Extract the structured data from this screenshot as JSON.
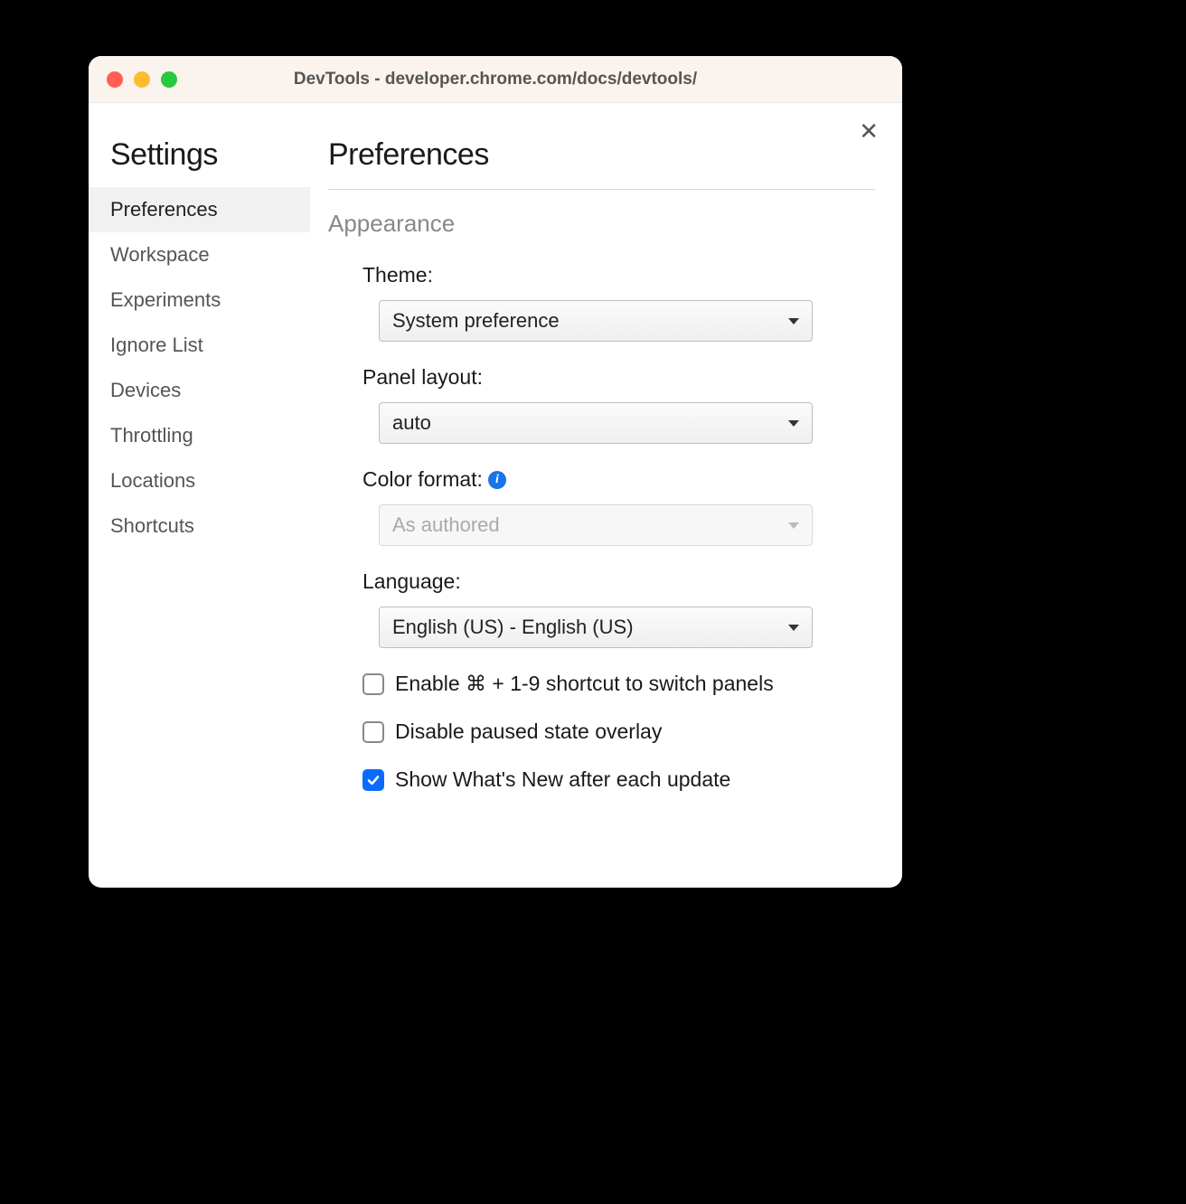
{
  "window": {
    "title": "DevTools - developer.chrome.com/docs/devtools/"
  },
  "sidebar": {
    "title": "Settings",
    "items": [
      {
        "label": "Preferences",
        "active": true
      },
      {
        "label": "Workspace",
        "active": false
      },
      {
        "label": "Experiments",
        "active": false
      },
      {
        "label": "Ignore List",
        "active": false
      },
      {
        "label": "Devices",
        "active": false
      },
      {
        "label": "Throttling",
        "active": false
      },
      {
        "label": "Locations",
        "active": false
      },
      {
        "label": "Shortcuts",
        "active": false
      }
    ]
  },
  "content": {
    "title": "Preferences",
    "section": "Appearance",
    "theme": {
      "label": "Theme:",
      "value": "System preference"
    },
    "panel_layout": {
      "label": "Panel layout:",
      "value": "auto"
    },
    "color_format": {
      "label": "Color format:",
      "value": "As authored",
      "disabled": true,
      "has_info": true
    },
    "language": {
      "label": "Language:",
      "value": "English (US) - English (US)"
    },
    "checkboxes": [
      {
        "label": "Enable ⌘ + 1-9 shortcut to switch panels",
        "checked": false
      },
      {
        "label": "Disable paused state overlay",
        "checked": false
      },
      {
        "label": "Show What's New after each update",
        "checked": true
      }
    ]
  }
}
